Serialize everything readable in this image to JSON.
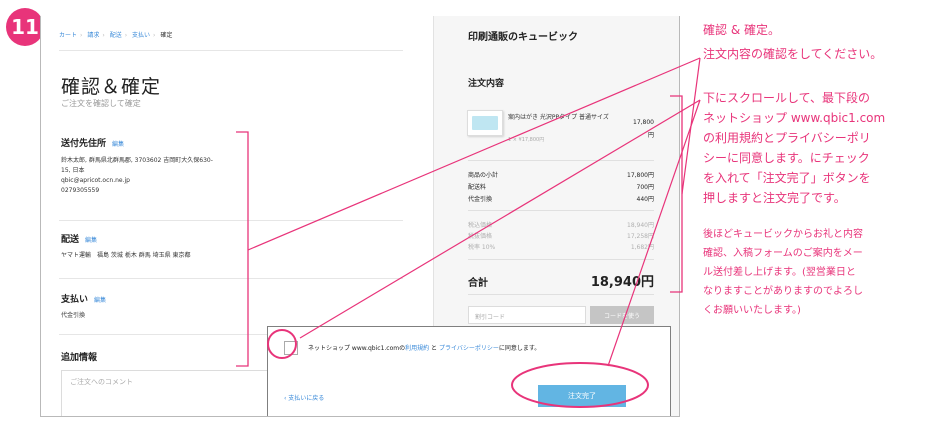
{
  "step_number": "11",
  "breadcrumb": [
    "カート",
    "請求",
    "配送",
    "支払い",
    "確定"
  ],
  "page": {
    "title": "確認＆確定",
    "subtitle": "ご注文を確認して確定"
  },
  "shipping": {
    "title": "送付先住所",
    "edit_label": "編集",
    "address_lines": [
      "鈴木太郎, 群馬県北群馬郡, 3703602 吉岡町大久保630-",
      "15, 日本",
      "qbic@apricot.ocn.ne.jp",
      "0279305559"
    ]
  },
  "delivery": {
    "title": "配送",
    "edit_label": "編集",
    "text": "ヤマト運輸　福島 茨城 栃木 群馬 埼玉県 東京都"
  },
  "payment": {
    "title": "支払い",
    "edit_label": "編集",
    "text": "代金引換"
  },
  "additional": {
    "title": "追加情報",
    "comment_placeholder": "ご注文へのコメント"
  },
  "summary": {
    "shop_name": "印刷通販のキュービック",
    "title": "注文内容",
    "product_name": "案内はがき 光沢PPタイプ 普通サイズ",
    "product_sub": "1 × ¥17,800円",
    "product_price": "17,800",
    "product_price_unit": "円",
    "rows": [
      {
        "label": "商品の小計",
        "value": "17,800円"
      },
      {
        "label": "配送料",
        "value": "700円"
      },
      {
        "label": "代金引換",
        "value": "440円"
      }
    ],
    "tax_rows": [
      {
        "label": "税込価格",
        "value": "18,940円"
      },
      {
        "label": "税抜価格",
        "value": "17,258円"
      },
      {
        "label": "税率 10%",
        "value": "1,682円"
      }
    ],
    "total_label": "合計",
    "total_value": "18,940円",
    "coupon_placeholder": "割引コード",
    "coupon_button": "コードを使う"
  },
  "agreement": {
    "prefix": "ネットショップ www.qbic1.comの",
    "terms_link": "利用規約",
    "middle": " と ",
    "privacy_link": "プライバシーポリシー",
    "suffix": "に同意します。",
    "back_label": "‹ 支払いに戻る",
    "complete_button": "注文完了"
  },
  "notes": {
    "note1": [
      "確認 & 確定。",
      "注文内容の確認をしてください。"
    ],
    "note2": [
      "下にスクロールして、最下段の",
      "ネットショップ www.qbic1.com",
      "の利用規約とプライバシーポリ",
      "シーに同意します。にチェック",
      "を入れて「注文完了」ボタンを",
      "押しますと注文完了です。"
    ],
    "note3": [
      "後ほどキュービックからお礼と内容",
      "確認、入稿フォームのご案内をメー",
      "ル送付差し上げます。(翌営業日と",
      "なりますことがありますのでよろし",
      "くお願いいたします。)"
    ]
  },
  "colors": {
    "accent": "#e8347a",
    "link": "#3a8ad9",
    "button": "#62b5e3"
  }
}
